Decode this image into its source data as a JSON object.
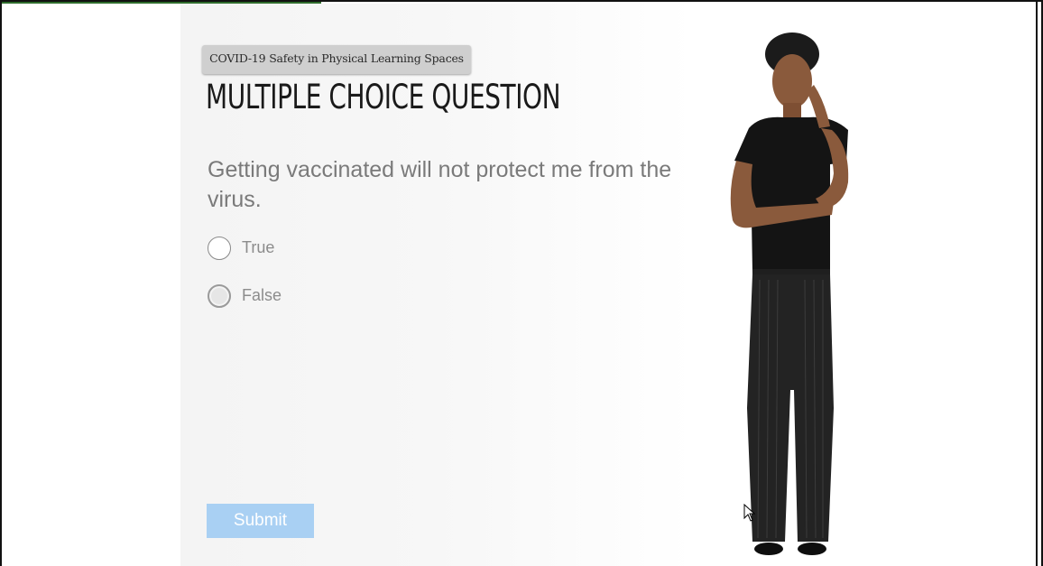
{
  "course": {
    "tag": "COVID-19 Safety in Physical Learning Spaces"
  },
  "question": {
    "heading": "MULTIPLE CHOICE QUESTION",
    "text": "Getting vaccinated will not protect me from the virus."
  },
  "choices": [
    {
      "label": "True",
      "state": "unselected"
    },
    {
      "label": "False",
      "state": "hover"
    }
  ],
  "submit": {
    "label": "Submit",
    "state": "disabled"
  },
  "colors": {
    "submit_bg": "#a9d0f3",
    "tag_bg": "#cfcfcf",
    "question_text": "#7a7a7a",
    "heading": "#1a1a1a"
  }
}
